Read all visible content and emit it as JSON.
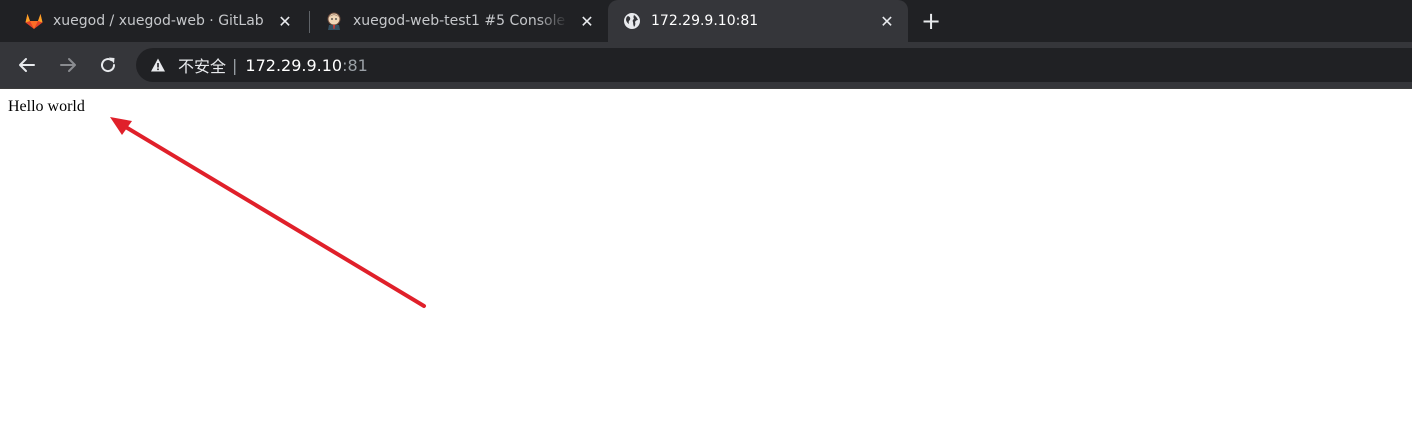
{
  "browser": {
    "tabs": [
      {
        "title": "xuegod / xuegod-web · GitLab",
        "icon": "gitlab-icon",
        "active": false,
        "close": "✕"
      },
      {
        "title": "xuegod-web-test1 #5 Console",
        "icon": "jenkins-icon",
        "active": false,
        "close": "✕"
      },
      {
        "title": "172.29.9.10:81",
        "icon": "globe-icon",
        "active": true,
        "close": "✕"
      }
    ],
    "new_tab": "+",
    "address": {
      "security_label": "不安全",
      "separator": "|",
      "host": "172.29.9.10",
      "port": ":81"
    }
  },
  "page": {
    "text": "Hello world",
    "annotation": {
      "type": "arrow",
      "color": "#e0202a"
    }
  },
  "colors": {
    "tabstrip": "#202124",
    "toolbar": "#35363a",
    "omnibox": "#202124",
    "accent_red": "#e0202a"
  }
}
